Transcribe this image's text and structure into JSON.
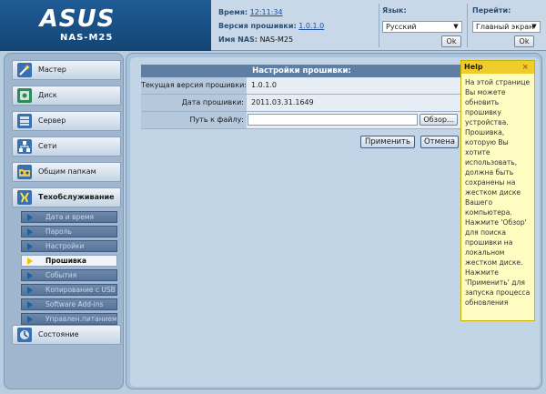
{
  "header": {
    "logo_text": "ASUS",
    "model": "NAS-M25",
    "time_label": "Время:",
    "time_value": "12:11:34",
    "firmware_label": "Версия прошивки:",
    "firmware_value": "1.0.1.0",
    "nas_name_label": "Имя NAS:",
    "nas_name_value": "NAS-M25",
    "language_label": "Язык:",
    "language_value": "Русский",
    "language_ok": "Ok",
    "goto_label": "Перейти:",
    "goto_value": "Главный экран",
    "goto_ok": "Ok"
  },
  "sidebar": {
    "items": [
      {
        "label": "Мастер",
        "icon": "wand-icon"
      },
      {
        "label": "Диск",
        "icon": "disk-icon"
      },
      {
        "label": "Сервер",
        "icon": "server-icon"
      },
      {
        "label": "Сети",
        "icon": "network-icon"
      },
      {
        "label": "Общим папкам",
        "icon": "shared-folder-icon"
      },
      {
        "label": "Техобслуживание",
        "icon": "tools-icon"
      },
      {
        "label": "Состояние",
        "icon": "status-icon"
      }
    ],
    "subitems": [
      {
        "label": "Дата и время"
      },
      {
        "label": "Пароль"
      },
      {
        "label": "Настройки"
      },
      {
        "label": "Прошивка"
      },
      {
        "label": "События"
      },
      {
        "label": "Копирование с USB"
      },
      {
        "label": "Software Add-ins"
      },
      {
        "label": "Управлен.питанием"
      }
    ]
  },
  "main": {
    "title": "Настройки прошивки:",
    "rows": [
      {
        "label": "Текущая версия прошивки:",
        "value": "1.0.1.0"
      },
      {
        "label": "Дата прошивки:",
        "value": "2011.03.31.1649"
      },
      {
        "label": "Путь к файлу:",
        "value": ""
      }
    ],
    "browse_label": "Обзор...",
    "apply_label": "Применить",
    "cancel_label": "Отмена"
  },
  "help": {
    "title": "Help",
    "close": "×",
    "lines": [
      "На этой странице",
      "Вы можете",
      "обновить",
      "прошивку",
      "устройства.",
      "Прошивка,",
      "которую Вы",
      "хотите",
      "использовать,",
      "должна быть",
      "сохранены на",
      "жестком диске",
      "Вашего",
      "компьютера.",
      "Нажмите 'Обзор'",
      "для поиска",
      "прошивки на",
      "локальном",
      "жестком диске.",
      "Нажмите",
      "'Применить' для",
      "запуска процесса",
      "обновления"
    ]
  },
  "colors": {
    "header_bg": "#c9d8e8",
    "logo_bg": "#1f5c96",
    "panel_title": "#5f7ea4",
    "help_bg": "#fefcc0",
    "help_title": "#f1cd2c",
    "active_submenu_arrow": "#f2c200"
  }
}
